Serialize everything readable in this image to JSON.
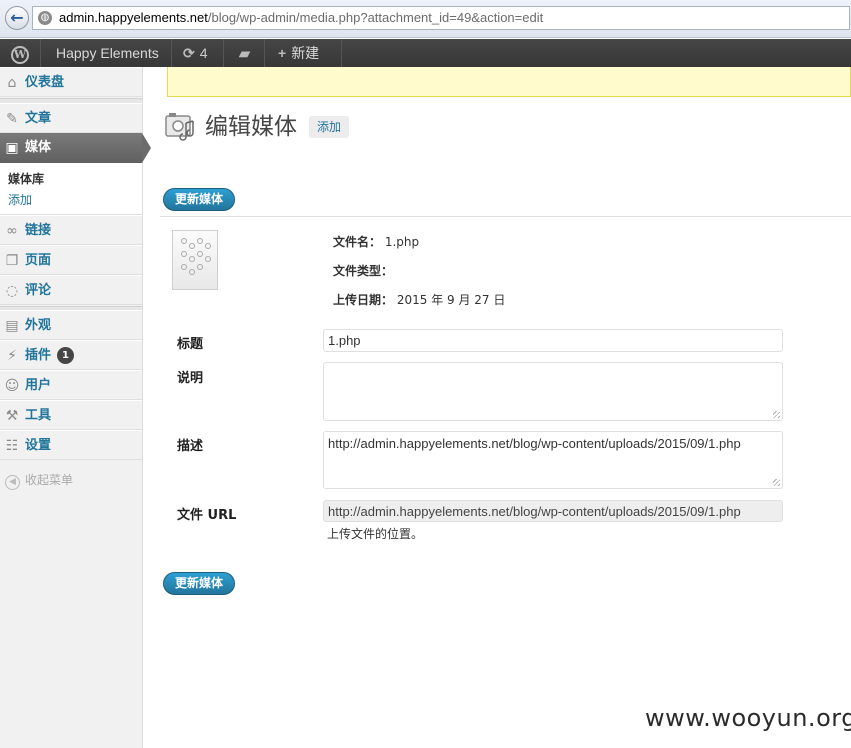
{
  "browser": {
    "url_domain": "admin.happyelements.net",
    "url_path": "/blog/wp-admin/media.php?attachment_id=49&action=edit"
  },
  "adminbar": {
    "site_name": "Happy Elements",
    "updates_count": "4",
    "new_label": "新建"
  },
  "sidebar": {
    "dashboard": "仪表盘",
    "posts": "文章",
    "media": "媒体",
    "media_sub": {
      "library": "媒体库",
      "add": "添加"
    },
    "links": "链接",
    "pages": "页面",
    "comments": "评论",
    "appearance": "外观",
    "plugins": "插件",
    "plugins_badge": "1",
    "users": "用户",
    "tools": "工具",
    "settings": "设置",
    "collapse": "收起菜单"
  },
  "main": {
    "title": "编辑媒体",
    "add_new": "添加",
    "update_button": "更新媒体",
    "file_info": {
      "filename_label": "文件名：",
      "filename_value": "1.php",
      "filetype_label": "文件类型：",
      "filetype_value": "",
      "upload_date_label": "上传日期：",
      "upload_date_value": "2015 年 9 月 27 日"
    },
    "fields": {
      "title_label": "标题",
      "title_value": "1.php",
      "caption_label": "说明",
      "caption_value": "",
      "description_label": "描述",
      "description_value": "http://admin.happyelements.net/blog/wp-content/uploads/2015/09/1.php",
      "file_url_label": "文件 URL",
      "file_url_value": "http://admin.happyelements.net/blog/wp-content/uploads/2015/09/1.php",
      "file_url_help": "上传文件的位置。"
    }
  },
  "watermark": "www.wooyun.org"
}
